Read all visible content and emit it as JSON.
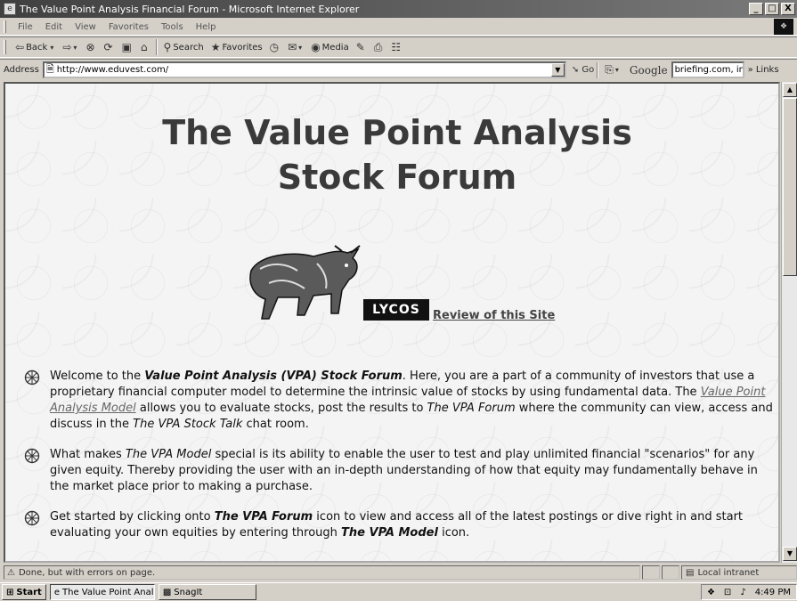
{
  "window": {
    "title": "The Value Point Analysis Financial Forum - Microsoft Internet Explorer",
    "minimize": "_",
    "maximize": "□",
    "close": "X"
  },
  "menu": [
    "File",
    "Edit",
    "View",
    "Favorites",
    "Tools",
    "Help"
  ],
  "toolbar": {
    "back": "Back",
    "search": "Search",
    "favorites": "Favorites",
    "media": "Media"
  },
  "address": {
    "label": "Address",
    "url": "http://www.eduvest.com/",
    "go": "Go",
    "google": "Google",
    "google_query": "briefing.com, indust",
    "links": "Links"
  },
  "page": {
    "title_line1": "The Value Point Analysis",
    "title_line2": "Stock Forum",
    "lycos": "LYCOS",
    "review_link": "Review of this Site",
    "bullets": [
      {
        "parts": [
          {
            "t": "Welcome to the ",
            "s": ""
          },
          {
            "t": "Value Point Analysis (VPA) Stock Forum",
            "s": "bold em"
          },
          {
            "t": ".  Here, you are a part of a community of investors that use a proprietary financial computer model to determine the intrinsic value of stocks by using fundamental data.  The ",
            "s": ""
          },
          {
            "t": "Value Point Analysis Model",
            "s": "link"
          },
          {
            "t": " allows you to evaluate stocks, post the results to ",
            "s": ""
          },
          {
            "t": "The VPA Forum",
            "s": "em"
          },
          {
            "t": " where the community can view, access and discuss in the ",
            "s": ""
          },
          {
            "t": "The VPA Stock Talk",
            "s": "em"
          },
          {
            "t": " chat room.",
            "s": ""
          }
        ]
      },
      {
        "parts": [
          {
            "t": "What makes ",
            "s": ""
          },
          {
            "t": "The VPA Model",
            "s": "em"
          },
          {
            "t": " special is its ability to enable the user to test and play unlimited financial \"scenarios\" for any given equity.  Thereby providing the user with an in-depth understanding of how that equity may fundamentally behave in the market place prior to making a purchase.",
            "s": ""
          }
        ]
      },
      {
        "parts": [
          {
            "t": "Get started by clicking onto ",
            "s": ""
          },
          {
            "t": "The VPA Forum",
            "s": "bold em"
          },
          {
            "t": " icon to view and access all of the latest postings or dive right in and start evaluating your own equities by entering through ",
            "s": ""
          },
          {
            "t": "The VPA Model",
            "s": "bold em"
          },
          {
            "t": " icon.",
            "s": ""
          }
        ]
      }
    ]
  },
  "status": {
    "text": "Done, but with errors on page.",
    "zone": "Local intranet"
  },
  "taskbar": {
    "start": "Start",
    "task_ie": "The Value Point Analysis ...",
    "task_snagit": "SnagIt",
    "clock": "4:49 PM"
  }
}
